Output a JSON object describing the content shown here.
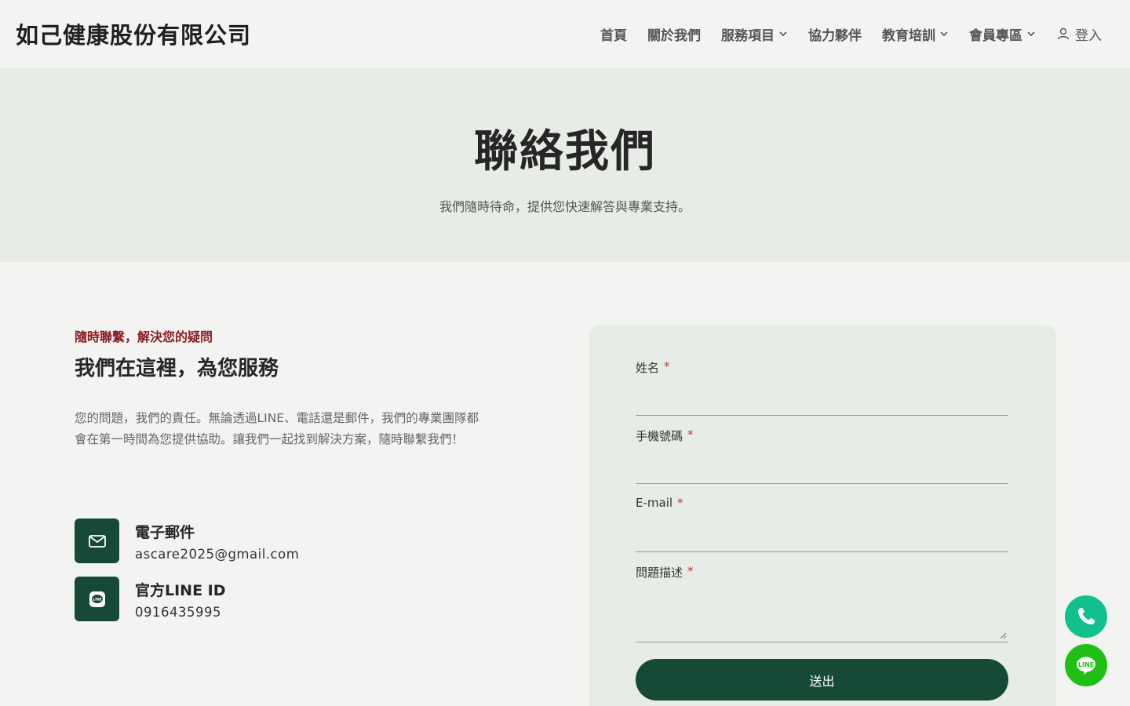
{
  "header": {
    "brand": "如己健康股份有限公司",
    "nav": [
      {
        "label": "首頁",
        "has_dropdown": false
      },
      {
        "label": "關於我們",
        "has_dropdown": false
      },
      {
        "label": "服務項目",
        "has_dropdown": true
      },
      {
        "label": "協力夥伴",
        "has_dropdown": false
      },
      {
        "label": "教育培訓",
        "has_dropdown": true
      },
      {
        "label": "會員專區",
        "has_dropdown": true
      }
    ],
    "login": "登入"
  },
  "hero": {
    "title": "聯絡我們",
    "subtitle": "我們隨時待命，提供您快速解答與專業支持。"
  },
  "info": {
    "eyebrow": "隨時聯繫，解決您的疑問",
    "title": "我們在這裡，為您服務",
    "description": "您的問題，我們的責任。無論透過LINE、電話還是郵件，我們的專業團隊都會在第一時間為您提供協助。讓我們一起找到解決方案，隨時聯繫我們！",
    "contacts": [
      {
        "icon": "mail-icon",
        "label": "電子郵件",
        "value": "ascare2025@gmail.com"
      },
      {
        "icon": "line-icon",
        "label": "官方LINE ID",
        "value": "0916435995"
      }
    ]
  },
  "form": {
    "fields": [
      {
        "label": "姓名",
        "required_mark": "*",
        "value": ""
      },
      {
        "label": "手機號碼",
        "required_mark": "*",
        "value": ""
      },
      {
        "label": "E-mail",
        "required_mark": "*",
        "value": ""
      },
      {
        "label": "問題描述",
        "required_mark": "*",
        "value": ""
      }
    ],
    "submit": "送出"
  },
  "floating": {
    "phone_icon": "phone-icon",
    "line_icon": "line-icon",
    "line_text": "LINE"
  },
  "colors": {
    "primary": "#174a36",
    "accent": "#8b1c24",
    "hero_bg": "#e8ece6",
    "page_bg": "#f3f4f1",
    "phone_green": "#12c08e",
    "line_green": "#1fbf16"
  }
}
